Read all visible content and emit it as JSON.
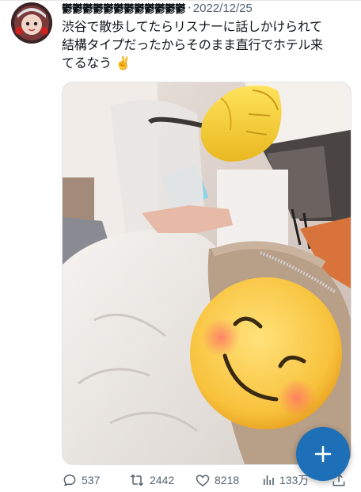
{
  "tweet": {
    "author_name": "鬱鬱鬱鬱鬱鬱鬱鬱鬱鬱鬱鬱",
    "separator": "·",
    "date": "2022/12/25",
    "text_line1": "渋谷で散歩してたらリスナーに話しかけられて",
    "text_line2": "結構タイプだったからそのまま直行でホテル来",
    "text_line3": "てるなう",
    "text_emoji": "✌️"
  },
  "stats": {
    "replies": "537",
    "retweets": "2442",
    "likes": "8218",
    "views": "133万"
  },
  "icons": {
    "reply": "reply-icon",
    "retweet": "retweet-icon",
    "like": "heart-icon",
    "views": "views-icon",
    "share": "share-icon",
    "compose": "plus-icon"
  },
  "colors": {
    "text": "#0f1419",
    "muted": "#536471",
    "fab": "#1d6fb8"
  }
}
